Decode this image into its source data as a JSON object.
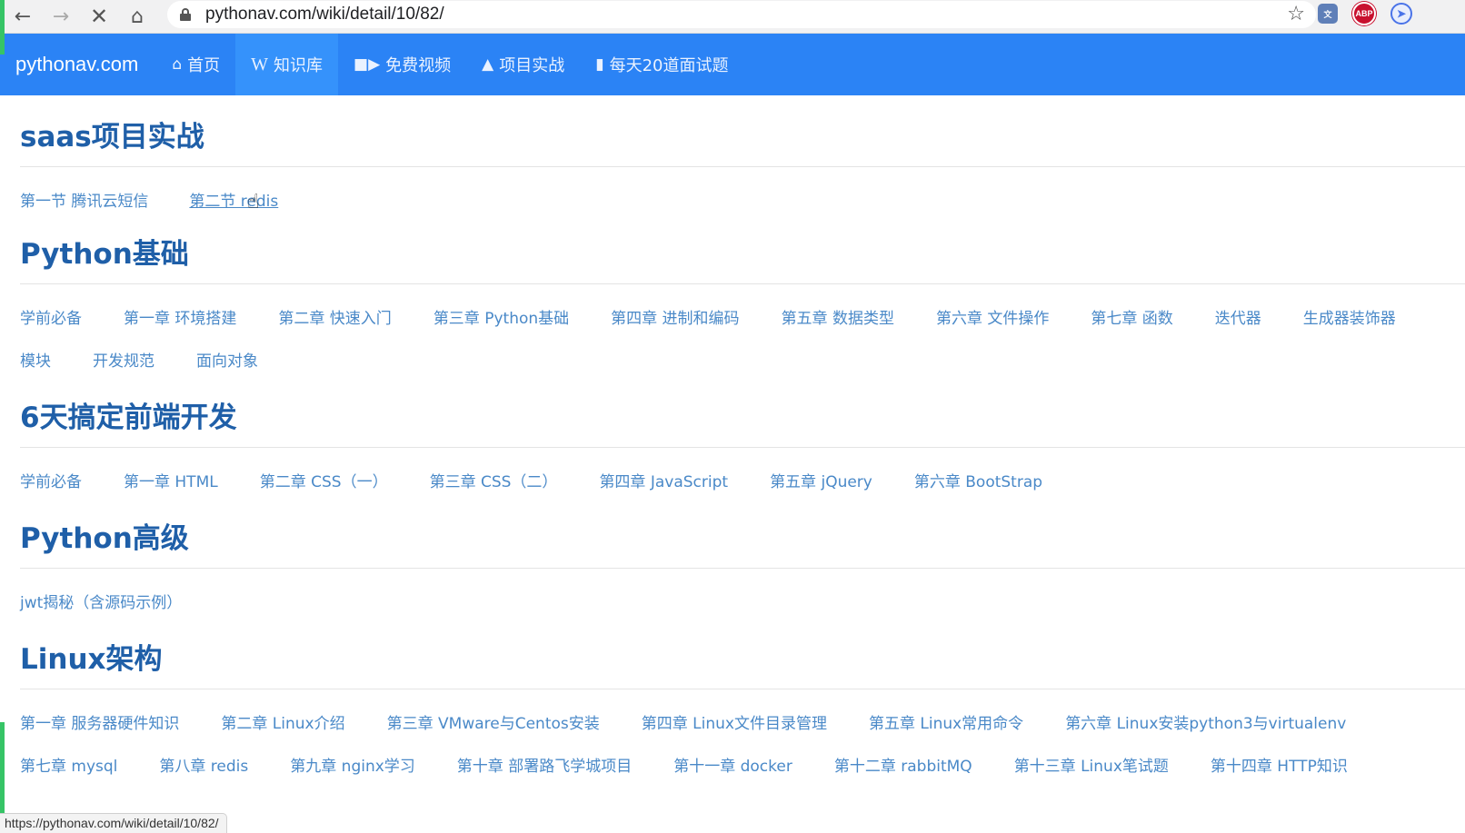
{
  "browser": {
    "url": "pythonav.com/wiki/detail/10/82/",
    "back_icon": "arrow-left-icon",
    "forward_icon": "arrow-right-icon",
    "stop_icon": "close-icon",
    "home_icon": "home-icon",
    "status_url": "https://pythonav.com/wiki/detail/10/82/",
    "extensions": [
      {
        "name": "translate-extension"
      },
      {
        "name": "adblock-extension",
        "label": "ABP"
      },
      {
        "name": "vpn-extension"
      }
    ]
  },
  "site_nav": {
    "brand": "pythonav.com",
    "items": [
      {
        "label": "首页",
        "icon": "home-icon"
      },
      {
        "label": "知识库",
        "icon": "wikipedia-icon",
        "active": true
      },
      {
        "label": "免费视频",
        "icon": "video-camera-icon"
      },
      {
        "label": "项目实战",
        "icon": "fire-icon"
      },
      {
        "label": "每天20道面试题",
        "icon": "book-icon"
      }
    ],
    "accent_color": "#2b83f5"
  },
  "sections": [
    {
      "title": "saas项目实战",
      "links": [
        "第一节 腾讯云短信",
        "第二节 redis"
      ]
    },
    {
      "title": "Python基础",
      "links": [
        "学前必备",
        "第一章 环境搭建",
        "第二章 快速入门",
        "第三章 Python基础",
        "第四章 进制和编码",
        "第五章 数据类型",
        "第六章 文件操作",
        "第七章 函数",
        "迭代器",
        "生成器",
        "装饰器",
        "模块",
        "开发规范",
        "面向对象"
      ]
    },
    {
      "title": "6天搞定前端开发",
      "links": [
        "学前必备",
        "第一章 HTML",
        "第二章 CSS（一）",
        "第三章 CSS（二）",
        "第四章 JavaScript",
        "第五章 jQuery",
        "第六章 BootStrap"
      ]
    },
    {
      "title": "Python高级",
      "links": [
        "jwt揭秘（含源码示例）"
      ]
    },
    {
      "title": "Linux架构",
      "links": [
        "第一章 服务器硬件知识",
        "第二章 Linux介绍",
        "第三章 VMware与Centos安装",
        "第四章 Linux文件目录管理",
        "第五章 Linux常用命令",
        "第六章 Linux安装python3与virtualenv",
        "第七章 mysql",
        "第八章 redis",
        "第九章 nginx学习",
        "第十章 部署路飞学城项目",
        "第十一章 docker",
        "第十二章 rabbitMQ",
        "第十三章 Linux笔试题",
        "第十四章 HTTP知识"
      ]
    }
  ],
  "colors": {
    "title": "#1f5fa8",
    "link": "#4a89c8"
  }
}
